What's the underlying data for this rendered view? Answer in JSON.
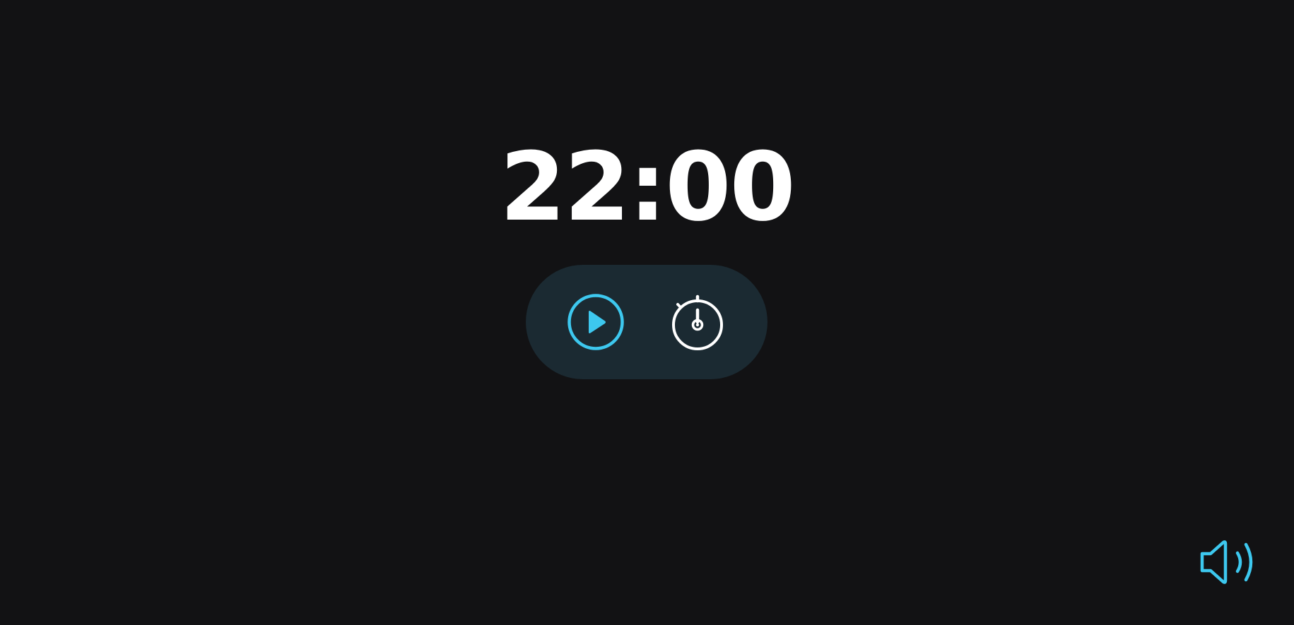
{
  "timer": {
    "display": "22:00"
  },
  "controls": {
    "play_icon": "play-circle-icon",
    "stopwatch_icon": "stopwatch-icon"
  },
  "sound": {
    "icon": "speaker-volume-icon"
  },
  "colors": {
    "background": "#121214",
    "pill": "#1b2a32",
    "accent": "#3dc8ef",
    "text": "#ffffff"
  }
}
